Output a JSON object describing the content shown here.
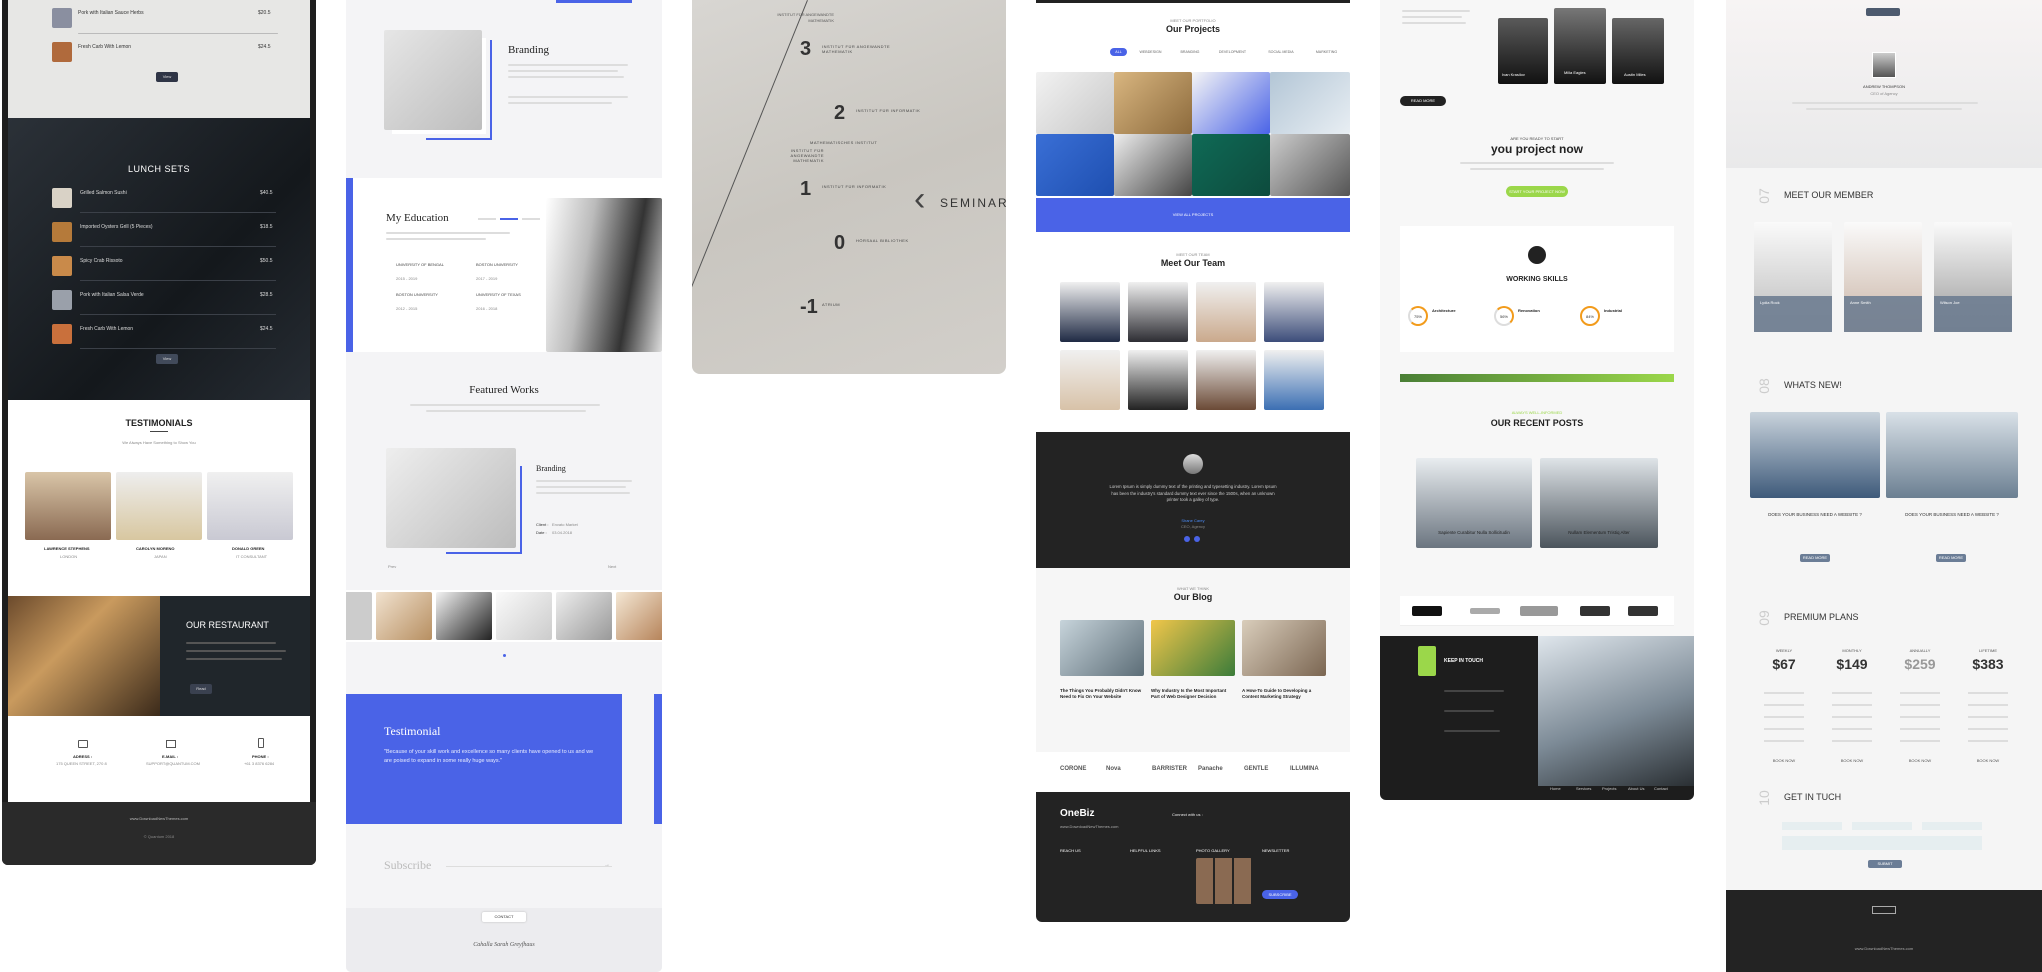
{
  "restaurant": {
    "top_items": [
      {
        "name": "Pork with Italian Sauce Herbs",
        "price": "$20.5"
      },
      {
        "name": "Fresh Carb With Lemon",
        "price": "$24.5"
      }
    ],
    "menu_button": "View",
    "lunch_title": "LUNCH SETS",
    "lunch_items": [
      {
        "name": "Grilled Salmon Sushi",
        "price": "$40.5"
      },
      {
        "name": "Imported Oysters Grill (5 Pieces)",
        "price": "$18.5"
      },
      {
        "name": "Spicy Crab Rissoto",
        "price": "$50.5"
      },
      {
        "name": "Pork with Italian Salsa Verde",
        "price": "$28.5"
      },
      {
        "name": "Fresh Carb With Lemon",
        "price": "$24.5"
      }
    ],
    "lunch_button": "View",
    "testimonials_title": "TESTIMONIALS",
    "testimonials_sub": "We Always Have Something to Show You",
    "people": [
      {
        "name": "LAWRENCE STEPHENS",
        "role": "LONDON"
      },
      {
        "name": "CAROLYN MORENO",
        "role": "JAPAN"
      },
      {
        "name": "DONALD GREEN",
        "role": "IT CONSULTANT"
      }
    ],
    "restaurant_title": "OUR RESTAURANT",
    "restaurant_button": "Read",
    "contacts": [
      {
        "label": "ADRESS :",
        "value": "175 QUEEN STREET, 270 8"
      },
      {
        "label": "E-MAIL :",
        "value": "SUPPORT@QUANTUM.COM"
      },
      {
        "label": "PHONE :",
        "value": "+61 3 8376 6284"
      }
    ],
    "footer_site": "www.DownloadNewThemes.com",
    "footer_copy": "© Quantum 2018"
  },
  "portfolio": {
    "branding_title": "Branding",
    "education_title": "My Education",
    "education_items": [
      {
        "school": "UNIVERSITY OF BENGAL",
        "years": "2015 - 2019"
      },
      {
        "school": "BOSTON UNIVERSITY",
        "years": "2017 - 2019"
      },
      {
        "school": "BOSTON UNIVERSITY",
        "years": "2012 - 2015"
      },
      {
        "school": "UNIVERSITY OF TEXAS",
        "years": "2016 - 2018"
      }
    ],
    "featured_title": "Featured Works",
    "featured_item_title": "Branding",
    "client_label": "Client :",
    "client_value": "Envato Market",
    "date_label": "Date :",
    "date_value": "03.04.2018",
    "prev_label": "Prev",
    "next_label": "Next",
    "testimonial_title": "Testimonial",
    "testimonial_quote": "\"Because of your skill work and excellence so many clients have opened to us and we are poised to expand in some really huge ways.\"",
    "subscribe_label": "Subscribe",
    "contact_label": "CONTACT",
    "signature": "Cahalla Sarah Greyfhaus"
  },
  "signage": {
    "floors": [
      {
        "number": "3",
        "text": "INSTITUT FÜR ANGEWANDTE MATHEMATIK"
      },
      {
        "number": "2",
        "text": "INSTITUT FÜR INFORMATIK"
      },
      {
        "number": "1",
        "text": "INSTITUT FÜR INFORMATIK"
      },
      {
        "number": "0",
        "text": "HÖRSAAL BIBLIOTHEK"
      },
      {
        "number": "-1",
        "text": "ATRIUM"
      }
    ],
    "top_text": "INSTITUT FÜR ANGEWANDTE MATHEMATIK",
    "mid_text_1": "MATHEMATISCHES INSTITUT",
    "mid_text_2": "INSTITUT FÜR ANGEWANDTE MATHEMATIK",
    "seminar_text": "SEMINAR"
  },
  "agency": {
    "projects_kicker": "MEET OUR PORTFOLIO",
    "projects_title": "Our Projects",
    "filters": [
      "ALL",
      "WEBDESIGN",
      "BRANDING",
      "DEVELOPMENT",
      "SOCIAL MEDIA",
      "MARKETING"
    ],
    "view_projects": "VIEW ALL PROJECTS",
    "team_kicker": "MEET OUR TEAM",
    "team_title": "Meet Our Team",
    "quote": "Lorem Ipsum is simply dummy text of the printing and typesetting industry. Lorem Ipsum has been the industry's standard dummy text ever since the 1500s, when an unknown printer took a galley of type.",
    "quote_name": "Shane Carey",
    "quote_role": "CEO, Agency",
    "blog_kicker": "WHAT WE THINK",
    "blog_title": "Our Blog",
    "blog_posts": [
      {
        "title": "The Things You Probably Didn't Know Need to Fix On Your Website"
      },
      {
        "title": "Why Industry Is the Most Important Part of Web Designer Decision"
      },
      {
        "title": "A How-To Guide to Developing a Content Marketing Strategy"
      }
    ],
    "brands": [
      "CORONE",
      "Nova",
      "BARRISTER",
      "Panache",
      "GENTLE",
      "ILLUMINA"
    ],
    "logo": "OneBiz",
    "footer_site": "www.DownloadNewThemes.com",
    "connect": "Connect with us :",
    "footer_cols": [
      "REACH US",
      "HELPFUL LINKS",
      "PHOTO GALLERY",
      "NEWSLETTER"
    ],
    "subscribe_btn": "SUBSCRIBE"
  },
  "studio": {
    "team": [
      {
        "name": "Ivan Krasilov",
        "role": "Creative"
      },
      {
        "name": "Milla Eagles",
        "role": "Designer"
      },
      {
        "name": "Austin Miles",
        "role": "Director"
      }
    ],
    "cta_kicker": "ARE YOU READY TO START",
    "cta_title": "you project now",
    "cta_button": "START YOUR PROJECT NOW",
    "read_more": "READ MORE",
    "skills_title": "WORKING SKILLS",
    "skills": [
      {
        "percent": "75%",
        "name": "Architecture"
      },
      {
        "percent": "56%",
        "name": "Renovation"
      },
      {
        "percent": "84%",
        "name": "Industrial"
      }
    ],
    "posts_kicker": "ALWAYS WELL-INFORMED",
    "posts_title": "OUR RECENT POSTS",
    "posts": [
      {
        "title": "Sapiente Curabitur Nulla Sollicitudin"
      },
      {
        "title": "Nullam Elementum Tristiq Alter"
      }
    ],
    "touch_title": "KEEP IN TOUCH",
    "nav": [
      "Home",
      "Services",
      "Projects",
      "About Us",
      "Contact"
    ]
  },
  "resume": {
    "author_name": "ANDREW THOMPSON",
    "author_role": "CEO of Agency",
    "member_num": "07",
    "member_title": "MEET OUR MEMBER",
    "members": [
      {
        "name": "Lydia Rock"
      },
      {
        "name": "Anne Smith"
      },
      {
        "name": "Wilson Joe"
      }
    ],
    "news_num": "08",
    "news_title": "WHATS NEW!",
    "news_items": [
      {
        "title": "DOES YOUR BUSINESS NEED A WEBSITE ?"
      },
      {
        "title": "DOES YOUR BUSINESS NEED A WEBSITE ?"
      }
    ],
    "read_more": "READ MORE",
    "plans_num": "09",
    "plans_title": "PREMIUM PLANS",
    "plans": [
      {
        "name": "WEEKLY",
        "price": "$67"
      },
      {
        "name": "MONTHLY",
        "price": "$149"
      },
      {
        "name": "ANNUALLY",
        "price": "$259"
      },
      {
        "name": "LIFETIME",
        "price": "$383"
      }
    ],
    "book_now": "BOOK NOW",
    "touch_num": "10",
    "touch_title": "GET IN TUCH",
    "submit": "SUBMIT",
    "footer_site": "www.DownloadNewThemes.com"
  }
}
